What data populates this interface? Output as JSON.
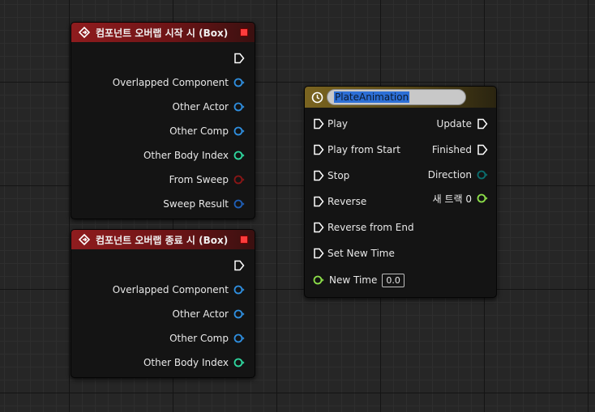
{
  "node_begin": {
    "title": "컴포넌트 오버랩 시작 시 (Box)",
    "pins": [
      "Overlapped Component",
      "Other Actor",
      "Other Comp",
      "Other Body Index",
      "From Sweep",
      "Sweep Result"
    ]
  },
  "node_end": {
    "title": "컴포넌트 오버랩 종료 시 (Box)",
    "pins": [
      "Overlapped Component",
      "Other Actor",
      "Other Comp",
      "Other Body Index"
    ]
  },
  "timeline": {
    "name": "PlateAnimation",
    "inputs": [
      "Play",
      "Play from Start",
      "Stop",
      "Reverse",
      "Reverse from End",
      "Set New Time"
    ],
    "outputs": [
      "Update",
      "Finished",
      "Direction",
      "새 트랙 0"
    ],
    "new_time_label": "New Time",
    "new_time_value": "0.0"
  },
  "colors": {
    "object_pin": "#2f8fe0",
    "int_pin": "#2fd9a0",
    "bool_pin": "#8a1616",
    "struct_pin": "#1f5fb8",
    "enum_pin": "#0a6e6e",
    "float_pin": "#8de04a",
    "exec_pin": "#ffffff"
  }
}
